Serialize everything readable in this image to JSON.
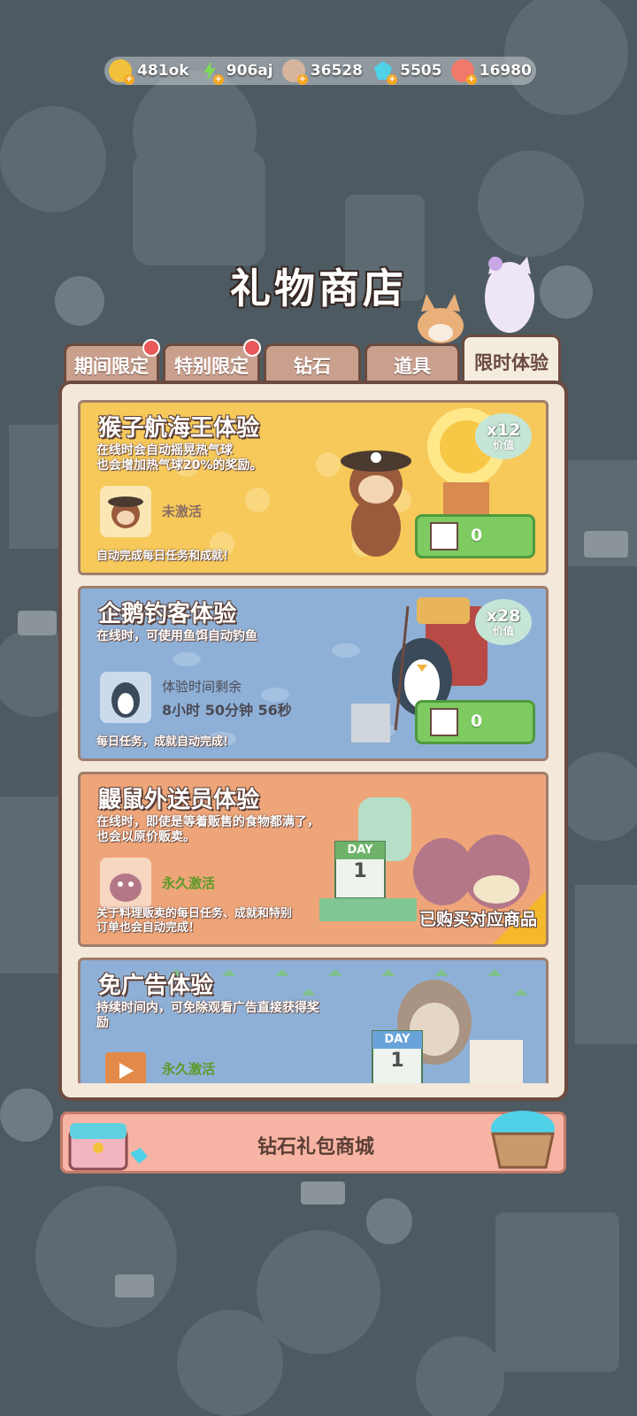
{
  "resources": [
    {
      "name": "coin",
      "value": "481ok",
      "color": "#f2c03a"
    },
    {
      "name": "energy",
      "value": "906aj",
      "color": "#7ed957"
    },
    {
      "name": "cookie",
      "value": "36528",
      "color": "#d7b49e"
    },
    {
      "name": "diamond",
      "value": "5505",
      "color": "#4fd2e8"
    },
    {
      "name": "candy",
      "value": "16980",
      "color": "#f07a6a"
    }
  ],
  "title": "礼物商店",
  "tabs": [
    {
      "label": "期间限定",
      "badge": true
    },
    {
      "label": "特别限定",
      "badge": true
    },
    {
      "label": "钻石",
      "badge": false
    },
    {
      "label": "道具",
      "badge": false
    },
    {
      "label": "限时体验",
      "badge": false,
      "active": true
    }
  ],
  "cards": [
    {
      "title": "猴子航海王体验",
      "desc": "在线时会自动摇晃热气球\n也会增加热气球20%的奖励。",
      "status": "未激活",
      "footer": "自动完成每日任务和成就！",
      "value_mult": "x12",
      "value_label": "价值",
      "price": "0",
      "bg": "#f6c95a"
    },
    {
      "title": "企鹅钓客体验",
      "desc": "在线时，可使用鱼饵自动钓鱼",
      "timer_label": "体验时间剩余",
      "timer_value": "8小时 50分钟 56秒",
      "footer": "每日任务，成就自动完成！",
      "value_mult": "x28",
      "value_label": "价值",
      "price": "0",
      "bg": "#8fb0d6"
    },
    {
      "title": "鼹鼠外送员体验",
      "desc": "在线时，即使是等着贩售的食物都满了，\n也会以原价贩卖。",
      "status": "永久激活",
      "footer": "关于料理贩卖的每日任务、成就和特别\n订单也会自动完成！",
      "purchased": "已购买对应商品",
      "day_label": "DAY",
      "day_num": "1",
      "bg": "#eea579"
    },
    {
      "title": "免广告体验",
      "desc": "持续时间内，可免除观看广告直接获得奖\n励",
      "status": "永久激活",
      "day_label": "DAY",
      "day_num": "1",
      "bg": "#8fb0d6"
    }
  ],
  "gift_button": "钻石礼包商城"
}
